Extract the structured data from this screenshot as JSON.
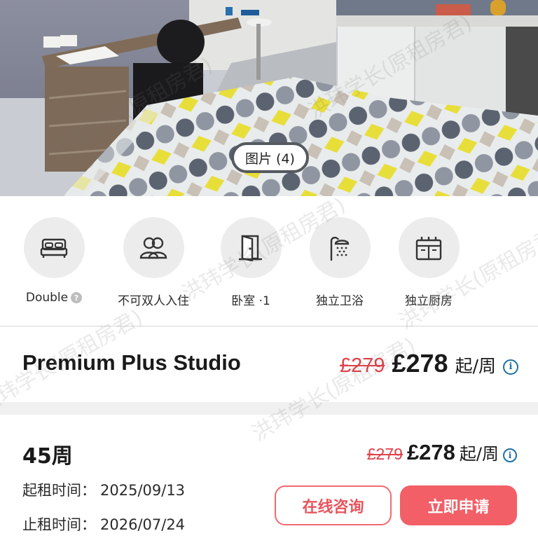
{
  "gallery": {
    "badge_label": "图片 (4)"
  },
  "watermark": {
    "text": "洪玮学长(原租房君)"
  },
  "amenities": [
    {
      "icon": "bed-icon",
      "label": "Double"
    },
    {
      "icon": "people-icon",
      "label": "不可双人入住"
    },
    {
      "icon": "door-icon",
      "label": "卧室 ·1"
    },
    {
      "icon": "shower-icon",
      "label": "独立卫浴"
    },
    {
      "icon": "stove-icon",
      "label": "独立厨房"
    }
  ],
  "room": {
    "title": "Premium Plus Studio",
    "old_price": "£279",
    "price": "£278",
    "unit": "起/周"
  },
  "tenancy": {
    "weeks": "45周",
    "start_label": "起租时间：",
    "start_date": "2025/09/13",
    "end_label": "止租时间：",
    "end_date": "2026/07/24",
    "old_price": "£279",
    "price": "£278",
    "unit": "起/周",
    "consult_label": "在线咨询",
    "apply_label": "立即申请"
  },
  "colors": {
    "accent": "#f25f67",
    "strike_price": "#e0404a",
    "info_blue": "#1e6fa8"
  }
}
